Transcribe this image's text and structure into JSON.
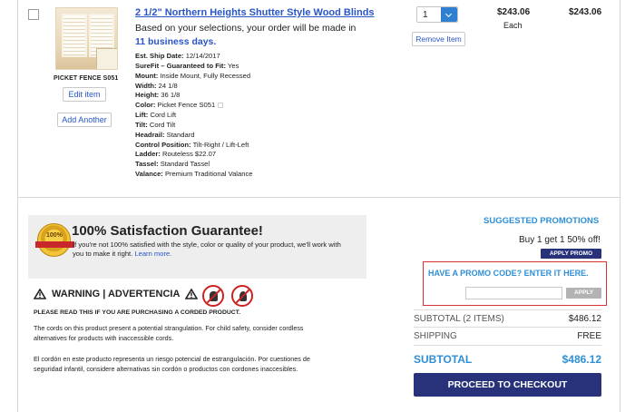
{
  "item": {
    "thumb_label": "PICKET FENCE S051",
    "edit_label": "Edit item",
    "add_another_label": "Add Another",
    "title": "2 1/2\" Northern Heights Shutter Style Wood Blinds",
    "note_prefix": "Based on your selections, your order will be made in",
    "note_days": "11 business days.",
    "specs": [
      {
        "label": "Est. Ship Date:",
        "value": "12/14/2017"
      },
      {
        "label": "SureFit – Guaranteed to Fit:",
        "value": "Yes"
      },
      {
        "label": "Mount:",
        "value": "Inside Mount, Fully Recessed"
      },
      {
        "label": "Width:",
        "value": "24 1/8"
      },
      {
        "label": "Height:",
        "value": "36 1/8"
      },
      {
        "label": "Color:",
        "value": "Picket Fence S051"
      },
      {
        "label": "Lift:",
        "value": "Cord Lift"
      },
      {
        "label": "Tilt:",
        "value": "Cord Tilt"
      },
      {
        "label": "Headrail:",
        "value": "Standard"
      },
      {
        "label": "Control Position:",
        "value": "Tilt-Right / Lift-Left"
      },
      {
        "label": "Ladder:",
        "value": "Routeless $22.07"
      },
      {
        "label": "Tassel:",
        "value": "Standard Tassel"
      },
      {
        "label": "Valance:",
        "value": "Premium Traditional Valance"
      }
    ],
    "quantity": "1",
    "remove_label": "Remove Item",
    "unit_price": "$243.06",
    "unit_label": "Each",
    "line_total": "$243.06"
  },
  "guarantee": {
    "badge_text": "100%",
    "title": "100% Satisfaction Guarantee!",
    "text": "If you're not 100% satisfied with the style, color or quality of your product, we'll work with you to make it right.",
    "link": "Learn more."
  },
  "warning": {
    "title": "WARNING | ADVERTENCIA",
    "sub": "PLEASE READ THIS IF YOU ARE PURCHASING A CORDED PRODUCT.",
    "english": "The cords on this product present a potential strangulation. For child safety, consider cordless alternatives for products with inaccessible cords.",
    "spanish": "El cordón en este producto representa un riesgo potencial de estrangulación. Por cuestiones de seguridad infantil, considere alternativas sin cordón o productos con cordones inaccesibles."
  },
  "summary": {
    "suggested_title": "SUGGESTED PROMOTIONS",
    "offer": "Buy 1 get 1 50% off!",
    "apply_promo_label": "APPLY PROMO",
    "promo_title": "HAVE A PROMO CODE? ENTER IT HERE.",
    "promo_placeholder": "",
    "promo_apply_label": "APPLY",
    "subtotal_label": "SUBTOTAL (2 ITEMS)",
    "subtotal_value": "$486.12",
    "shipping_label": "SHIPPING",
    "shipping_value": "FREE",
    "total_label": "SUBTOTAL",
    "total_value": "$486.12",
    "checkout_label": "PROCEED TO CHECKOUT"
  },
  "colors": {
    "link_blue": "#2855c8",
    "accent_blue": "#2e8fd6",
    "navy": "#27327a",
    "highlight_red": "#d93232"
  }
}
